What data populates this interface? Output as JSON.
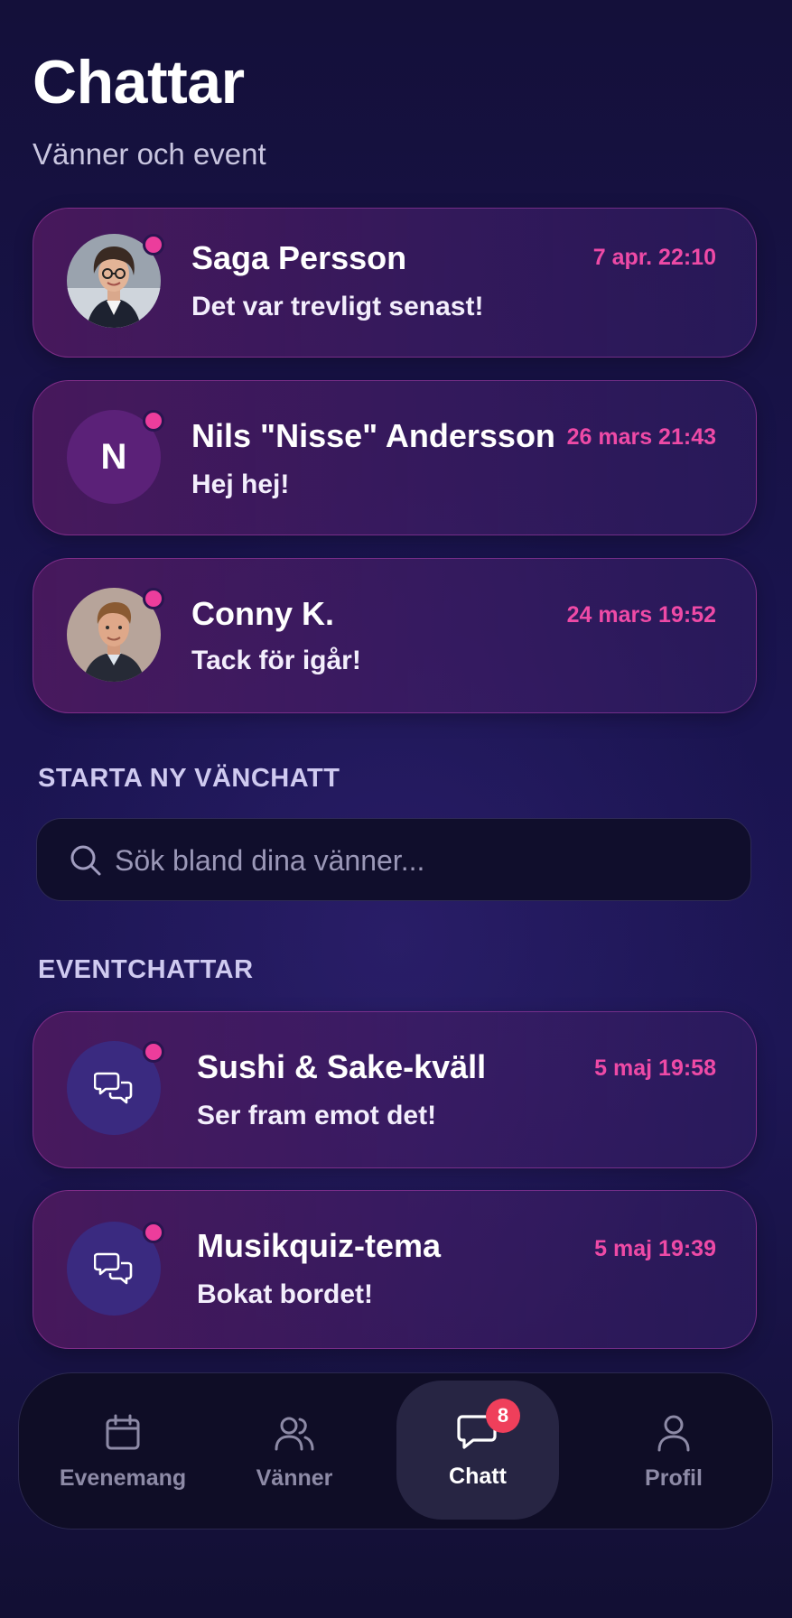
{
  "header": {
    "title": "Chattar",
    "subtitle": "Vänner och event"
  },
  "friend_chats": [
    {
      "name": "Saga Persson",
      "message": "Det var trevligt senast!",
      "time": "7 apr. 22:10",
      "avatar": "photo"
    },
    {
      "name": "Nils \"Nisse\" Andersson",
      "message": "Hej hej!",
      "time": "26 mars 21:43",
      "avatar": "letter",
      "initial": "N"
    },
    {
      "name": "Conny K.",
      "message": "Tack för igår!",
      "time": "24 mars 19:52",
      "avatar": "photo"
    }
  ],
  "new_chat": {
    "section_label": "STARTA NY VÄNCHATT",
    "search_placeholder": "Sök bland dina vänner..."
  },
  "event_chats": {
    "section_label": "EVENTCHATTAR",
    "items": [
      {
        "name": "Sushi & Sake-kväll",
        "message": "Ser fram emot det!",
        "time": "5 maj 19:58",
        "icon": "chat-bubbles-icon"
      },
      {
        "name": "Musikquiz-tema",
        "message": "Bokat bordet!",
        "time": "5 maj 19:39",
        "icon": "chat-bubbles-icon"
      }
    ]
  },
  "bottom_nav": {
    "items": [
      {
        "label": "Evenemang",
        "icon": "calendar-icon"
      },
      {
        "label": "Vänner",
        "icon": "users-icon"
      },
      {
        "label": "Chatt",
        "icon": "chat-icon",
        "active": true,
        "badge": "8"
      },
      {
        "label": "Profil",
        "icon": "user-icon"
      }
    ]
  },
  "colors": {
    "accent": "#ec3d9c",
    "time": "#ee4aa6",
    "badge": "#ef3f5b",
    "background": "#1a1450"
  }
}
